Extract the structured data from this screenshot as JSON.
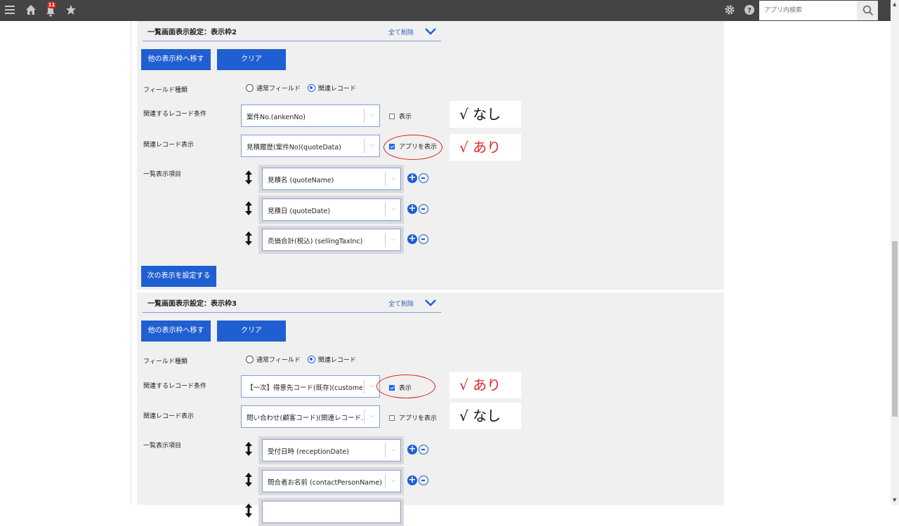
{
  "topbar": {
    "notification_count": "11",
    "search_placeholder": "アプリ内検索"
  },
  "panels": [
    {
      "title": "一覧画面表示設定：表示枠2",
      "delete_all": "全て削除",
      "move_button": "他の表示枠へ移す",
      "clear_button": "クリア",
      "field_type_label": "フィールド種類",
      "radio_normal": "通常フィールド",
      "radio_related": "関連レコード",
      "condition_label": "関連するレコード条件",
      "condition_value": "案件No.(ankenNo)",
      "condition_check_label": "表示",
      "related_display_label": "関連レコード表示",
      "related_display_value": "見積履歴(案件No)(quoteData)",
      "related_display_check_label": "アプリを表示",
      "list_items_label": "一覧表示項目",
      "items": [
        "見積名 (quoteName)",
        "見積日 (quoteDate)",
        "売価合計(税込) (sellingTaxInc)"
      ],
      "next_button": "次の表示を設定する",
      "annot_condition": "√ なし",
      "annot_related": "√ あり"
    },
    {
      "title": "一覧画面表示設定：表示枠3",
      "delete_all": "全て削除",
      "move_button": "他の表示枠へ移す",
      "clear_button": "クリア",
      "field_type_label": "フィールド種類",
      "radio_normal": "通常フィールド",
      "radio_related": "関連レコード",
      "condition_label": "関連するレコード条件",
      "condition_value": "【一次】得意先コード(既存)(custome…",
      "condition_check_label": "表示",
      "related_display_label": "関連レコード表示",
      "related_display_value": "問い合わせ(顧客コード)(関連レコード…",
      "related_display_check_label": "アプリを表示",
      "list_items_label": "一覧表示項目",
      "items": [
        "受付日時 (receptionDate)",
        "問合者お名前 (contactPersonName)",
        ""
      ],
      "annot_condition": "√ あり",
      "annot_related": "√ なし"
    }
  ],
  "colors": {
    "accent": "#1f5fd1",
    "annotation_red": "#e02a2a",
    "topbar": "#444444"
  }
}
